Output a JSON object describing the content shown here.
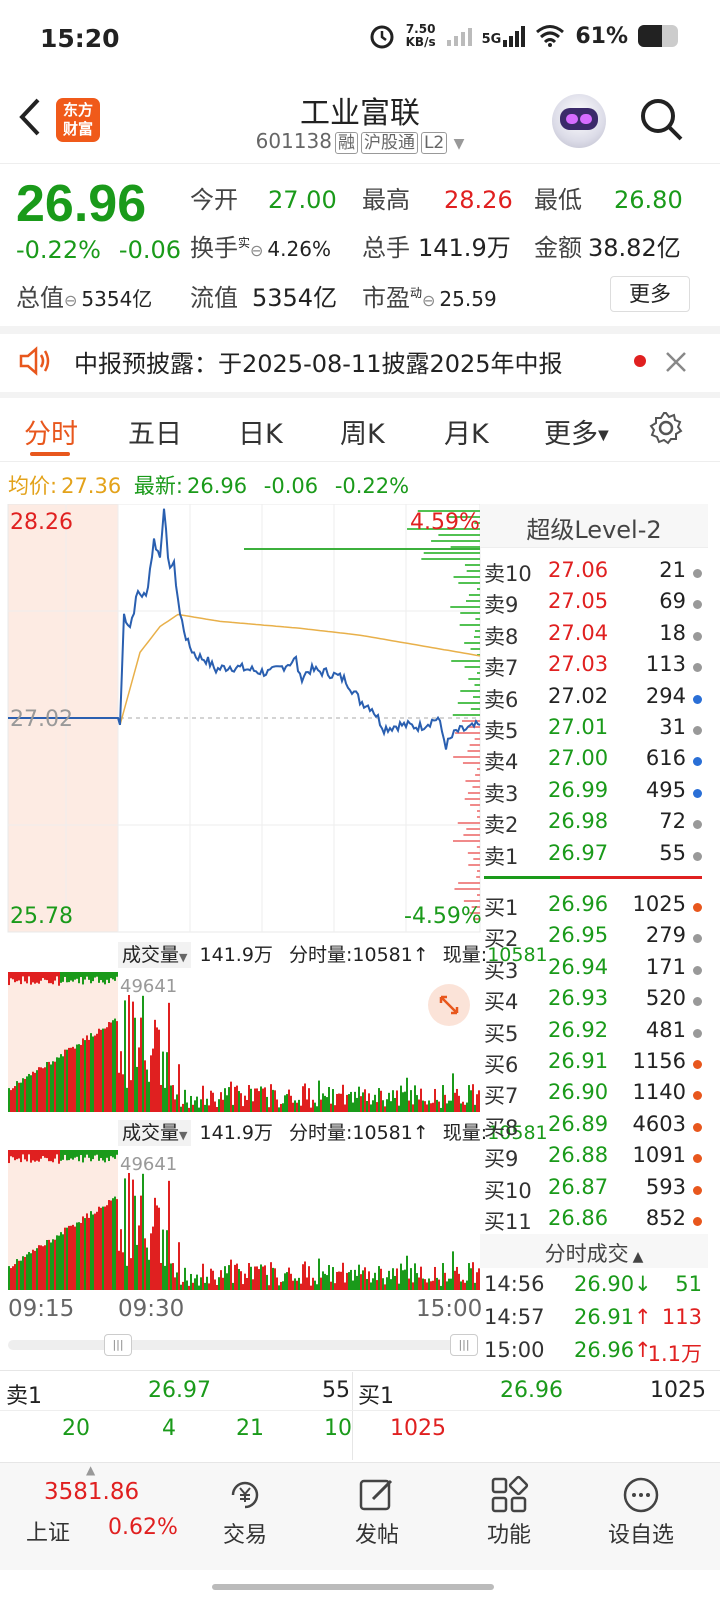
{
  "status_bar": {
    "time": "15:20",
    "net_speed": "7.50",
    "net_unit": "KB/s",
    "net_type": "5G",
    "battery": "61%",
    "battery_level": 0.61
  },
  "header": {
    "title": "工业富联",
    "code": "601138",
    "tags": [
      "融",
      "沪股通",
      "L2"
    ],
    "logo_line1": "东方",
    "logo_line2": "财富"
  },
  "quote": {
    "price": "26.96",
    "change_pct": "-0.22%",
    "change": "-0.06",
    "open_label": "今开",
    "open": "27.00",
    "high_label": "最高",
    "high": "28.26",
    "low_label": "最低",
    "low": "26.80",
    "turnover_label": "换手",
    "turnover_sup": "实",
    "turnover": "4.26%",
    "volume_label": "总手",
    "volume": "141.9万",
    "amount_label": "金额",
    "amount": "38.82亿",
    "mktcap_label": "总值",
    "mktcap": "5354亿",
    "float_label": "流值",
    "float": "5354亿",
    "pe_label": "市盈",
    "pe_sup": "动",
    "pe": "25.59",
    "more": "更多"
  },
  "notice": {
    "text": "中报预披露：于2025-08-11披露2025年中报"
  },
  "tabs": [
    "分时",
    "五日",
    "日K",
    "周K",
    "月K",
    "更多"
  ],
  "avg_line": {
    "avg_label": "均价:",
    "avg": "27.36",
    "last_label": "最新:",
    "last": "26.96",
    "chg": "-0.06",
    "pct": "-0.22%"
  },
  "chart": {
    "top_price": "28.26",
    "top_pct": "4.59%",
    "mid_price": "27.02",
    "bottom_price": "25.78",
    "bottom_pct": "-4.59%",
    "vol_label": "成交量",
    "vol_total": "141.9万",
    "vol_period": "分时量:10581↑",
    "vol_now_label": "现量:",
    "vol_now": "10581",
    "vol_max": "49641",
    "time_start": "09:15",
    "time_open": "09:30",
    "time_end": "15:00"
  },
  "level2": {
    "title": "超级Level-2",
    "asks": [
      {
        "label": "卖10",
        "price": "27.06",
        "vol": "21",
        "dot": "#999"
      },
      {
        "label": "卖9",
        "price": "27.05",
        "vol": "69",
        "dot": "#999"
      },
      {
        "label": "卖8",
        "price": "27.04",
        "vol": "18",
        "dot": "#999"
      },
      {
        "label": "卖7",
        "price": "27.03",
        "vol": "113",
        "dot": "#999"
      },
      {
        "label": "卖6",
        "price": "27.02",
        "vol": "294",
        "dot": "#2a6fd6"
      },
      {
        "label": "卖5",
        "price": "27.01",
        "vol": "31",
        "dot": "#999"
      },
      {
        "label": "卖4",
        "price": "27.00",
        "vol": "616",
        "dot": "#2a6fd6"
      },
      {
        "label": "卖3",
        "price": "26.99",
        "vol": "495",
        "dot": "#2a6fd6"
      },
      {
        "label": "卖2",
        "price": "26.98",
        "vol": "72",
        "dot": "#999"
      },
      {
        "label": "卖1",
        "price": "26.97",
        "vol": "55",
        "dot": "#999"
      }
    ],
    "bids": [
      {
        "label": "买1",
        "price": "26.96",
        "vol": "1025",
        "dot": "#e8571d"
      },
      {
        "label": "买2",
        "price": "26.95",
        "vol": "279",
        "dot": "#999"
      },
      {
        "label": "买3",
        "price": "26.94",
        "vol": "171",
        "dot": "#999"
      },
      {
        "label": "买4",
        "price": "26.93",
        "vol": "520",
        "dot": "#999"
      },
      {
        "label": "买5",
        "price": "26.92",
        "vol": "481",
        "dot": "#999"
      },
      {
        "label": "买6",
        "price": "26.91",
        "vol": "1156",
        "dot": "#e8571d"
      },
      {
        "label": "买7",
        "price": "26.90",
        "vol": "1140",
        "dot": "#e8571d"
      },
      {
        "label": "买8",
        "price": "26.89",
        "vol": "4603",
        "dot": "#e8571d"
      },
      {
        "label": "买9",
        "price": "26.88",
        "vol": "1091",
        "dot": "#e8571d"
      },
      {
        "label": "买10",
        "price": "26.87",
        "vol": "593",
        "dot": "#e8571d"
      },
      {
        "label": "买11",
        "price": "26.86",
        "vol": "852",
        "dot": "#e8571d"
      }
    ],
    "ticks_title": "分时成交",
    "ticks": [
      {
        "time": "14:56",
        "price": "26.90",
        "arrow": "↓",
        "vol": "51",
        "dir": "dn"
      },
      {
        "time": "14:57",
        "price": "26.91",
        "arrow": "↑",
        "vol": "113",
        "dir": "up"
      },
      {
        "time": "15:00",
        "price": "26.96",
        "arrow": "↑",
        "vol": "1.1万",
        "dir": "up"
      }
    ]
  },
  "book_summary": {
    "ask_label": "卖1",
    "ask_price": "26.97",
    "ask_vol": "55",
    "bid_label": "买1",
    "bid_price": "26.96",
    "bid_vol": "1025",
    "ask_queue": [
      "20",
      "4",
      "21",
      "10"
    ],
    "bid_queue": [
      "1025"
    ]
  },
  "bottom_nav": {
    "index_value": "3581.86",
    "index_name": "上证",
    "index_pct": "0.62%",
    "items": [
      "交易",
      "发帖",
      "功能",
      "设自选"
    ]
  }
}
